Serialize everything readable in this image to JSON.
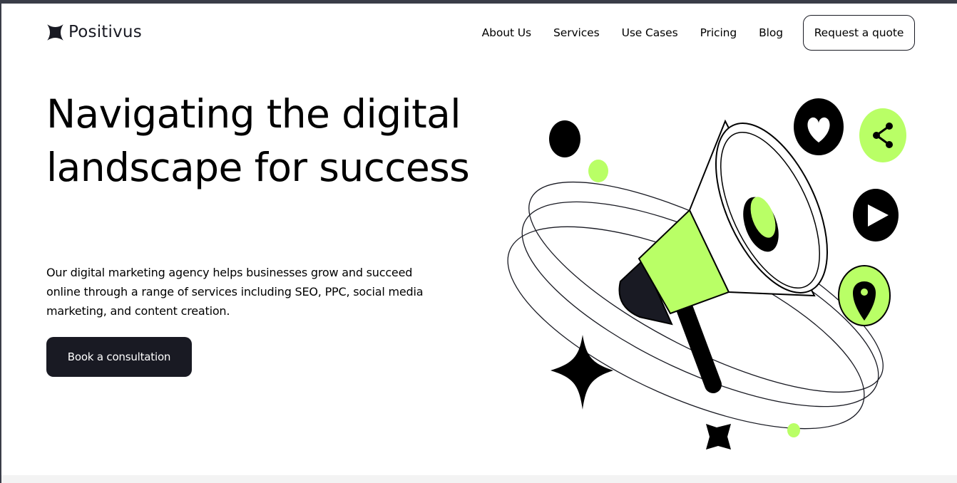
{
  "brand": {
    "name": "Positivus",
    "logo_icon": "sparkle-star-logo-icon"
  },
  "nav": {
    "items": [
      {
        "label": "About Us"
      },
      {
        "label": "Services"
      },
      {
        "label": "Use Cases"
      },
      {
        "label": "Pricing"
      },
      {
        "label": "Blog"
      }
    ],
    "cta_label": "Request a quote"
  },
  "hero": {
    "title": "Navigating the digital landscape for success",
    "description": "Our digital marketing agency helps businesses grow and succeed online through a range of services including SEO, PPC, social media marketing, and content creation.",
    "cta_label": "Book a consultation"
  },
  "illustration": {
    "main_icon": "megaphone-icon",
    "badges": [
      "heart-icon",
      "share-icon",
      "play-icon",
      "location-pin-icon"
    ],
    "decorations": [
      "four-point-star-icon",
      "small-star-icon",
      "dot-icon"
    ]
  },
  "colors": {
    "accent": "#B9FF66",
    "dark": "#191A23",
    "background": "#FFFFFF",
    "frame": "#3A3D48"
  }
}
